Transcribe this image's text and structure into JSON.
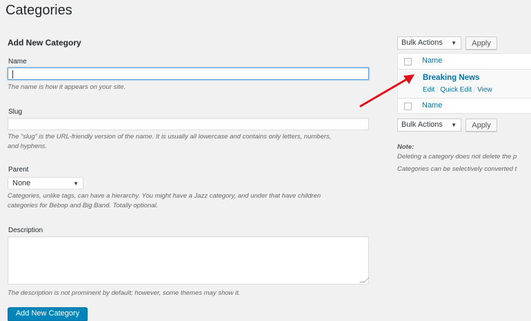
{
  "page": {
    "title": "Categories"
  },
  "form": {
    "heading": "Add New Category",
    "name": {
      "label": "Name",
      "value": "",
      "help": "The name is how it appears on your site."
    },
    "slug": {
      "label": "Slug",
      "value": "",
      "help1": "The “slug” is the URL-friendly version of the name. It is usually all lowercase and contains only letters, numbers,",
      "help2": "and hyphens."
    },
    "parent": {
      "label": "Parent",
      "selected": "None",
      "help1": "Categories, unlike tags, can have a hierarchy. You might have a Jazz category, and under that have children",
      "help2": "categories for Bebop and Big Band. Totally optional."
    },
    "description": {
      "label": "Description",
      "value": "",
      "help": "The description is not prominent by default; however, some themes may show it."
    },
    "submit_label": "Add New Category"
  },
  "list": {
    "bulk_top": {
      "selected": "Bulk Actions",
      "apply": "Apply"
    },
    "bulk_bottom": {
      "selected": "Bulk Actions",
      "apply": "Apply"
    },
    "column_header": "Name",
    "column_footer": "Name",
    "rows": [
      {
        "name": "Breaking News",
        "actions": [
          "Edit",
          "Quick Edit",
          "View"
        ]
      }
    ],
    "note_title": "Note:",
    "note1": "Deleting a category does not delete the p",
    "note2": "Categories can be selectively converted t"
  },
  "colors": {
    "link": "#0073aa",
    "primary": "#0085ba",
    "arrow": "#e3101b"
  }
}
